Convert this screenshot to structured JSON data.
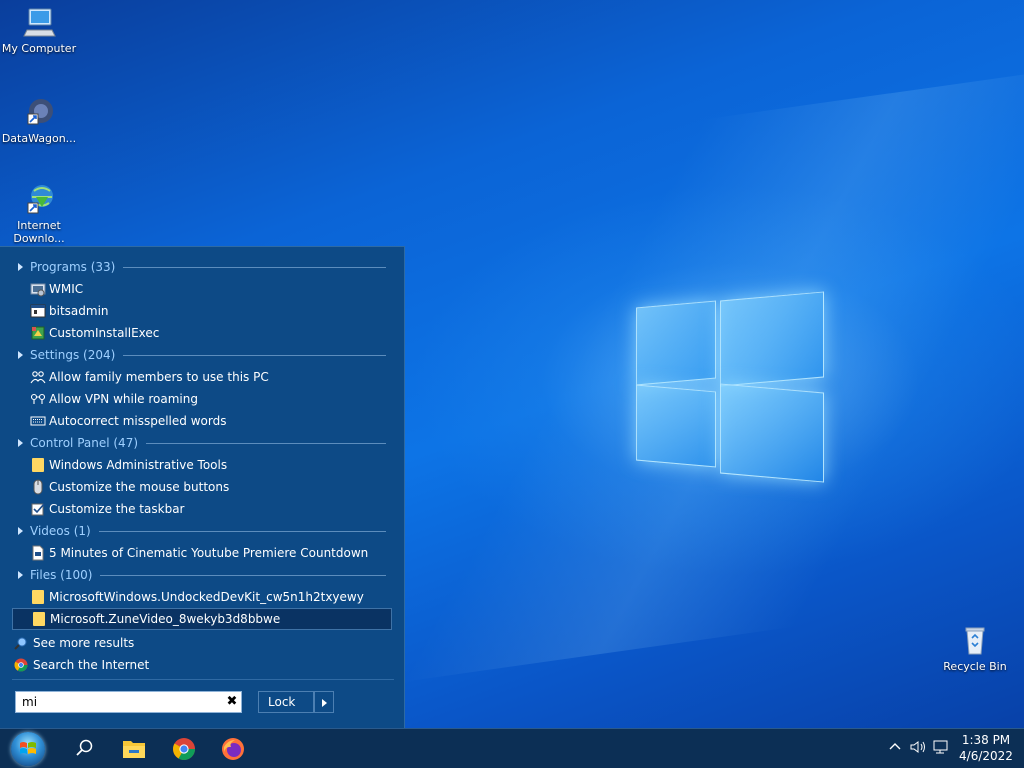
{
  "desktop": {
    "icons": [
      {
        "label": "My Computer",
        "icon": "computer-icon"
      },
      {
        "label": "DataWagon...",
        "icon": "datawagon-icon"
      },
      {
        "label": "Internet Downlo...",
        "icon": "internet-download-manager-icon"
      },
      {
        "label": "Recycle Bin",
        "icon": "recycle-bin-icon"
      }
    ]
  },
  "start_menu": {
    "groups": [
      {
        "header": "Programs (33)",
        "items": [
          "WMIC",
          "bitsadmin",
          "CustomInstallExec"
        ]
      },
      {
        "header": "Settings (204)",
        "items": [
          "Allow family members to use this PC",
          "Allow VPN while roaming",
          "Autocorrect misspelled words"
        ]
      },
      {
        "header": "Control Panel (47)",
        "items": [
          "Windows Administrative Tools",
          "Customize the mouse buttons",
          "Customize the taskbar"
        ]
      },
      {
        "header": "Videos (1)",
        "items": [
          "5 Minutes of Cinematic Youtube Premiere Countdown"
        ]
      },
      {
        "header": "Files (100)",
        "items": [
          "MicrosoftWindows.UndockedDevKit_cw5n1h2txyewy",
          "Microsoft.ZuneVideo_8wekyb3d8bbwe"
        ]
      }
    ],
    "selected_item": "Microsoft.ZuneVideo_8wekyb3d8bbwe",
    "see_more": "See more results",
    "search_internet": "Search the Internet",
    "search_value": "mi",
    "lock_label": "Lock"
  },
  "taskbar": {
    "apps": [
      "start-orb",
      "search-icon",
      "file-explorer-icon",
      "chrome-icon",
      "firefox-icon"
    ],
    "time": "1:38 PM",
    "date": "4/6/2022"
  },
  "colors": {
    "panel_bg": "#0d4a86",
    "header_text": "#9fd0ff",
    "taskbar_bg": "#0c2f55",
    "selection_bg": "#0a3363"
  }
}
